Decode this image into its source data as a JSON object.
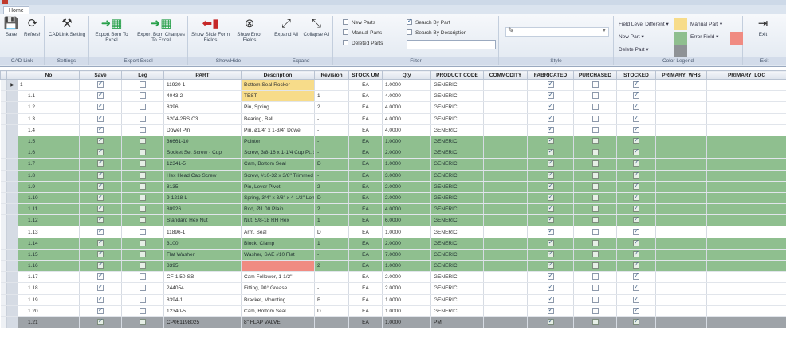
{
  "tabs": [
    "Home"
  ],
  "ribbon": {
    "groups": {
      "cadlink": "CAD Link",
      "settings": "Settings",
      "export_excel": "Export Excel",
      "show_hide": "Show/Hide",
      "expand": "Expand",
      "filter": "Filter",
      "style": "Style",
      "color_legend": "Color Legend",
      "exit": "Exit"
    },
    "buttons": {
      "save": "Save",
      "refresh": "Refresh",
      "cadlink_setting": "CADLink Setting",
      "export_bom": "Export Bom To Excel",
      "export_bom_changes": "Export Bom Changes To Excel",
      "show_slide": "Show Slide Form Fields",
      "show_error": "Show Error Fields",
      "expand_all": "Expand All",
      "collapse_all": "Collapse All",
      "exit": "Exit"
    },
    "filter": {
      "new_parts": "New Parts",
      "manual_parts": "Manual Parts",
      "deleted_parts": "Deleted Parts",
      "search_by_part": "Search By Part",
      "search_by_description": "Search By Description"
    },
    "legend": {
      "field_level_different": "Field Level Different",
      "new_part": "New Part",
      "delete_part": "Delete Part",
      "manual_part": "Manual Part",
      "error_field": "Error Field",
      "colors": {
        "yellow": "#f7dc8a",
        "green": "#8fbf8f",
        "gray": "#8e9296",
        "red": "#f08b82"
      }
    }
  },
  "grid": {
    "columns": [
      "No",
      "Save",
      "Leg",
      "PART",
      "Description",
      "Revision",
      "STOCK UM",
      "Qty",
      "PRODUCT CODE",
      "COMMODITY",
      "FABRICATED",
      "PURCHASED",
      "STOCKED",
      "PRIMARY_WHS",
      "PRIMARY_LOC"
    ],
    "rows": [
      {
        "no": "1",
        "save": true,
        "leg": false,
        "part": "11920-1",
        "desc": "Bottom Seal Rocker",
        "rev": "",
        "um": "EA",
        "qty": "1.0000",
        "code": "GENERIC",
        "fab": true,
        "pur": false,
        "stk": true,
        "style": "parent",
        "hl": "desc-yellow"
      },
      {
        "no": "1.1",
        "save": true,
        "leg": false,
        "part": "4043-2",
        "desc": "TEST",
        "rev": "1",
        "um": "EA",
        "qty": "4.0000",
        "code": "GENERIC",
        "fab": true,
        "pur": false,
        "stk": true,
        "style": "",
        "hl": "desc-yellow"
      },
      {
        "no": "1.2",
        "save": true,
        "leg": false,
        "part": "8396",
        "desc": "Pin, Spring",
        "rev": "2",
        "um": "EA",
        "qty": "4.0000",
        "code": "GENERIC",
        "fab": true,
        "pur": false,
        "stk": true,
        "style": "",
        "hl": ""
      },
      {
        "no": "1.3",
        "save": true,
        "leg": false,
        "part": "6204-2RS C3",
        "desc": "Bearing, Ball",
        "rev": "-",
        "um": "EA",
        "qty": "4.0000",
        "code": "GENERIC",
        "fab": true,
        "pur": false,
        "stk": true,
        "style": "",
        "hl": ""
      },
      {
        "no": "1.4",
        "save": true,
        "leg": false,
        "part": "Dowel Pin",
        "desc": "Pin, ø1/4\" x 1-3/4\" Dowel",
        "rev": "-",
        "um": "EA",
        "qty": "4.0000",
        "code": "GENERIC",
        "fab": true,
        "pur": false,
        "stk": true,
        "style": "",
        "hl": ""
      },
      {
        "no": "1.5",
        "save": true,
        "leg": false,
        "part": "36661-10",
        "desc": "Pointer",
        "rev": "-",
        "um": "EA",
        "qty": "1.0000",
        "code": "GENERIC",
        "fab": true,
        "pur": false,
        "stk": true,
        "style": "green",
        "hl": ""
      },
      {
        "no": "1.6",
        "save": true,
        "leg": false,
        "part": "Socket Set Screw - Cup",
        "desc": "Screw, 3/8-16 x 1-1/4 Cup Pt. Socket",
        "rev": "-",
        "um": "EA",
        "qty": "2.0000",
        "code": "GENERIC",
        "fab": true,
        "pur": false,
        "stk": true,
        "style": "green",
        "hl": ""
      },
      {
        "no": "1.7",
        "save": true,
        "leg": false,
        "part": "12341-5",
        "desc": "Cam, Bottom Seal",
        "rev": "D",
        "um": "EA",
        "qty": "1.0000",
        "code": "GENERIC",
        "fab": true,
        "pur": false,
        "stk": true,
        "style": "green",
        "hl": ""
      },
      {
        "no": "1.8",
        "save": true,
        "leg": false,
        "part": "Hex Head Cap Screw",
        "desc": "Screw, #10-32 x 3/8\" Trimmed Head",
        "rev": "-",
        "um": "EA",
        "qty": "3.0000",
        "code": "GENERIC",
        "fab": true,
        "pur": false,
        "stk": true,
        "style": "green",
        "hl": ""
      },
      {
        "no": "1.9",
        "save": true,
        "leg": false,
        "part": "8135",
        "desc": "Pin, Lever Pivot",
        "rev": "2",
        "um": "EA",
        "qty": "2.0000",
        "code": "GENERIC",
        "fab": true,
        "pur": false,
        "stk": true,
        "style": "green",
        "hl": ""
      },
      {
        "no": "1.10",
        "save": true,
        "leg": false,
        "part": "9-1218-L",
        "desc": "Spring, 3/4\" x 3/8\" x 4-1/2\" Long Die",
        "rev": "D",
        "um": "EA",
        "qty": "2.0000",
        "code": "GENERIC",
        "fab": true,
        "pur": false,
        "stk": true,
        "style": "green",
        "hl": ""
      },
      {
        "no": "1.11",
        "save": true,
        "leg": false,
        "part": "80926",
        "desc": "Rod, Ø1.00 Plain",
        "rev": "2",
        "um": "EA",
        "qty": "4.0000",
        "code": "GENERIC",
        "fab": true,
        "pur": false,
        "stk": true,
        "style": "green",
        "hl": ""
      },
      {
        "no": "1.12",
        "save": true,
        "leg": false,
        "part": "Standard Hex Nut",
        "desc": "Nut, 5/8-18 RH Hex",
        "rev": "1",
        "um": "EA",
        "qty": "6.0000",
        "code": "GENERIC",
        "fab": true,
        "pur": false,
        "stk": true,
        "style": "green",
        "hl": ""
      },
      {
        "no": "1.13",
        "save": true,
        "leg": false,
        "part": "11896-1",
        "desc": "Arm, Seal",
        "rev": "D",
        "um": "EA",
        "qty": "1.0000",
        "code": "GENERIC",
        "fab": true,
        "pur": false,
        "stk": true,
        "style": "",
        "hl": ""
      },
      {
        "no": "1.14",
        "save": true,
        "leg": false,
        "part": "3100",
        "desc": "Block, Clamp",
        "rev": "1",
        "um": "EA",
        "qty": "2.0000",
        "code": "GENERIC",
        "fab": true,
        "pur": false,
        "stk": true,
        "style": "green",
        "hl": ""
      },
      {
        "no": "1.15",
        "save": true,
        "leg": false,
        "part": "Flat Washer",
        "desc": "Washer, SAE #10 Flat",
        "rev": "-",
        "um": "EA",
        "qty": "7.0000",
        "code": "GENERIC",
        "fab": true,
        "pur": false,
        "stk": true,
        "style": "green",
        "hl": ""
      },
      {
        "no": "1.16",
        "save": true,
        "leg": false,
        "part": "8395",
        "desc": "",
        "rev": "2",
        "um": "EA",
        "qty": "1.0000",
        "code": "GENERIC",
        "fab": true,
        "pur": false,
        "stk": true,
        "style": "green",
        "hl": "desc-red"
      },
      {
        "no": "1.17",
        "save": true,
        "leg": false,
        "part": "CF-1.50-SB",
        "desc": "Cam Follower, 1-1/2\"",
        "rev": "",
        "um": "EA",
        "qty": "2.0000",
        "code": "GENERIC",
        "fab": true,
        "pur": false,
        "stk": true,
        "style": "",
        "hl": ""
      },
      {
        "no": "1.18",
        "save": true,
        "leg": false,
        "part": "244054",
        "desc": "Fitting, 90° Grease",
        "rev": "-",
        "um": "EA",
        "qty": "2.0000",
        "code": "GENERIC",
        "fab": true,
        "pur": false,
        "stk": true,
        "style": "",
        "hl": ""
      },
      {
        "no": "1.19",
        "save": true,
        "leg": false,
        "part": "8394-1",
        "desc": "Bracket, Mounting",
        "rev": "B",
        "um": "EA",
        "qty": "1.0000",
        "code": "GENERIC",
        "fab": true,
        "pur": false,
        "stk": true,
        "style": "",
        "hl": ""
      },
      {
        "no": "1.20",
        "save": true,
        "leg": false,
        "part": "12340-5",
        "desc": "Cam, Bottom Seal",
        "rev": "D",
        "um": "EA",
        "qty": "1.0000",
        "code": "GENERIC",
        "fab": true,
        "pur": false,
        "stk": true,
        "style": "",
        "hl": ""
      },
      {
        "no": "1.21",
        "save": true,
        "leg": false,
        "part": "CP061198025",
        "desc": "8\" FLAP VALVE",
        "rev": "",
        "um": "EA",
        "qty": "1.0000",
        "code": "PM",
        "fab": true,
        "pur": false,
        "stk": true,
        "style": "dark",
        "hl": ""
      }
    ]
  }
}
